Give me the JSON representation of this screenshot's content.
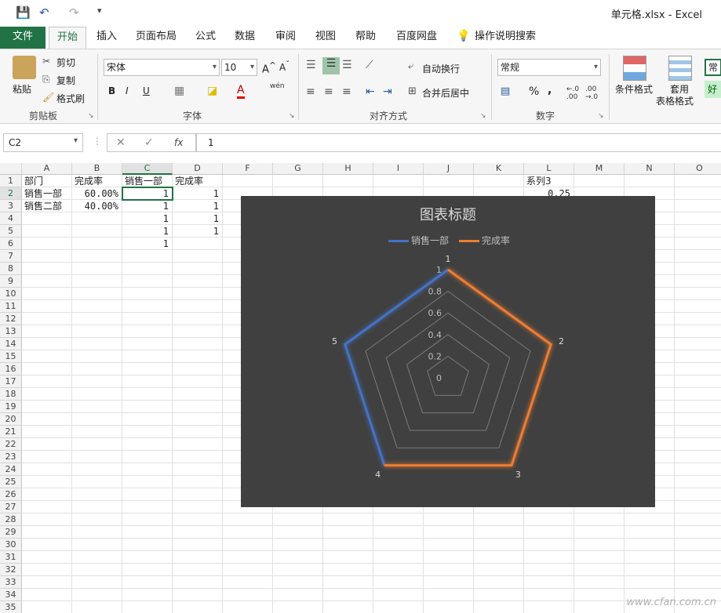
{
  "window": {
    "title": "单元格.xlsx  -  Excel"
  },
  "qat": {
    "save": "💾",
    "undo": "↶",
    "redo": "↷",
    "more": "▾"
  },
  "tabs": [
    {
      "label": "文件"
    },
    {
      "label": "开始"
    },
    {
      "label": "插入"
    },
    {
      "label": "页面布局"
    },
    {
      "label": "公式"
    },
    {
      "label": "数据"
    },
    {
      "label": "审阅"
    },
    {
      "label": "视图"
    },
    {
      "label": "帮助"
    },
    {
      "label": "百度网盘"
    }
  ],
  "tell_me": "操作说明搜索",
  "ribbon": {
    "clipboard": {
      "paste": "粘贴",
      "cut": "剪切",
      "copy": "复制",
      "format_painter": "格式刷",
      "label": "剪贴板"
    },
    "font": {
      "name": "宋体",
      "size": "10",
      "bold": "B",
      "italic": "I",
      "underline": "U",
      "label": "字体",
      "wen": "wén"
    },
    "alignment": {
      "wrap": "自动换行",
      "merge": "合并后居中",
      "label": "对齐方式"
    },
    "number": {
      "format": "常规",
      "label": "数字",
      "percent": "%",
      "comma": ","
    },
    "styles": {
      "conditional": "条件格式",
      "table": "套用",
      "table2": "表格格式",
      "style_normal": "常",
      "style_good": "好"
    }
  },
  "formula_bar": {
    "cell_ref": "C2",
    "cancel": "✕",
    "enter": "✓",
    "fx": "fx",
    "value": "1"
  },
  "columns": [
    "A",
    "B",
    "C",
    "D",
    "F",
    "G",
    "H",
    "I",
    "J",
    "K",
    "L",
    "M",
    "N",
    "O"
  ],
  "rows": [
    "1",
    "2",
    "3",
    "4",
    "5",
    "6",
    "7",
    "8",
    "9",
    "10",
    "11",
    "12",
    "13",
    "14",
    "15",
    "16",
    "17",
    "18",
    "19",
    "20",
    "21",
    "22",
    "23",
    "24",
    "25",
    "26",
    "27",
    "28",
    "29",
    "30",
    "31",
    "32",
    "33",
    "34",
    "35"
  ],
  "cells": {
    "A1": "部门",
    "B1": "完成率",
    "C1": "销售一部",
    "D1": "完成率",
    "A2": "销售一部",
    "B2": "60.00%",
    "C2": "1",
    "D2": "1",
    "A3": "销售二部",
    "B3": "40.00%",
    "C3": "1",
    "D3": "1",
    "C4": "1",
    "D4": "1",
    "C5": "1",
    "D5": "1",
    "C6": "1",
    "L1": "系列3",
    "L2": "0.25"
  },
  "chart_data": {
    "type": "radar",
    "title": "图表标题",
    "categories": [
      "1",
      "2",
      "3",
      "4",
      "5"
    ],
    "series": [
      {
        "name": "销售一部",
        "values": [
          1,
          1,
          1,
          1,
          1
        ],
        "color": "#4472c4"
      },
      {
        "name": "完成率",
        "values": [
          1,
          1,
          1,
          1,
          1
        ],
        "color": "#ed7d31"
      }
    ],
    "axis_ticks": [
      "0",
      "0.2",
      "0.4",
      "0.6",
      "0.8",
      "1"
    ],
    "ylim": [
      0,
      1
    ],
    "legend": "top",
    "background": "#404040"
  },
  "watermark": "www.cfan.com.cn"
}
